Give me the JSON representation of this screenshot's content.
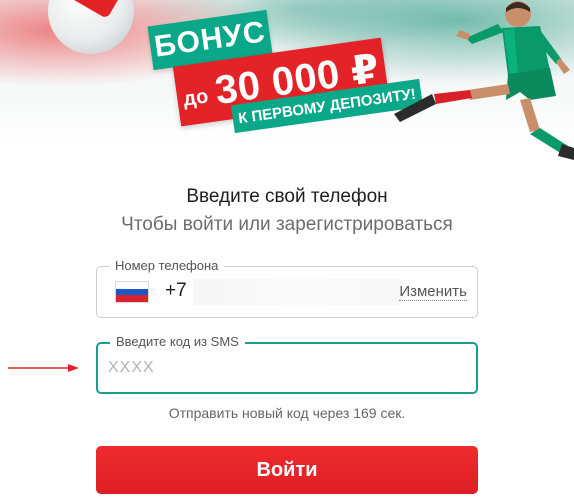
{
  "banner": {
    "bonus_label": "БОНУС",
    "amount_prefix": "до",
    "amount": "30 000 ₽",
    "deposit_label": "К ПЕРВОМУ ДЕПОЗИТУ!",
    "colors": {
      "red": "#e42328",
      "green": "#0aa889"
    }
  },
  "form": {
    "title": "Введите свой телефон",
    "subtitle": "Чтобы войти или зарегистрироваться",
    "phone": {
      "legend": "Номер телефона",
      "country_flag": "russia-flag-icon",
      "country_code": "+7",
      "change_link": "Изменить"
    },
    "sms": {
      "legend": "Введите код из SMS",
      "placeholder": "XXXX",
      "value": ""
    },
    "resend_text": "Отправить новый код через 169 сек.",
    "submit_label": "Войти",
    "accent_color": "#18a08a",
    "button_color": "#e42328",
    "annotation": "red-arrow-icon"
  }
}
